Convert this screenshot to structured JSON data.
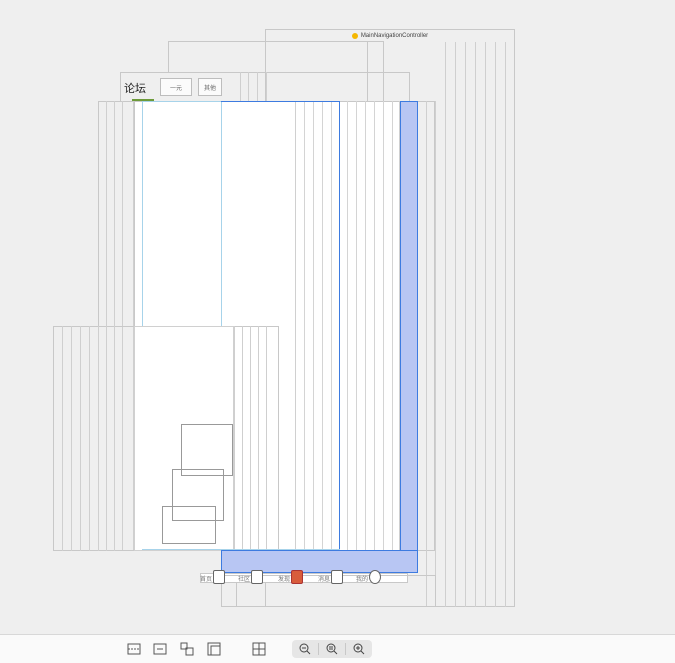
{
  "navigation_controller": {
    "title": "MainNavigationController",
    "icon": "yellow-circle-icon"
  },
  "forum_header": {
    "title": "论坛",
    "segments": [
      "一元",
      "其他"
    ]
  },
  "tab_bar": {
    "items": [
      {
        "label": "首页",
        "icon": "home-icon"
      },
      {
        "label": "社区",
        "icon": "chat-icon"
      },
      {
        "label": "发现",
        "icon": "gift-icon",
        "active": true
      },
      {
        "label": "消息",
        "icon": "message-icon"
      },
      {
        "label": "我的",
        "icon": "profile-icon"
      }
    ]
  },
  "bottom_toolbar": {
    "buttons": [
      "fit-height-icon",
      "fit-width-icon",
      "embed-icon",
      "layout-icon",
      "grid-icon"
    ],
    "zoom": [
      "zoom-out-icon",
      "zoom-reset-icon",
      "zoom-in-icon"
    ]
  },
  "colors": {
    "selection": "#b8c6f3",
    "selection_border": "#3d7be0",
    "canvas": "#efefef",
    "active_tab": "#d85c3c"
  }
}
